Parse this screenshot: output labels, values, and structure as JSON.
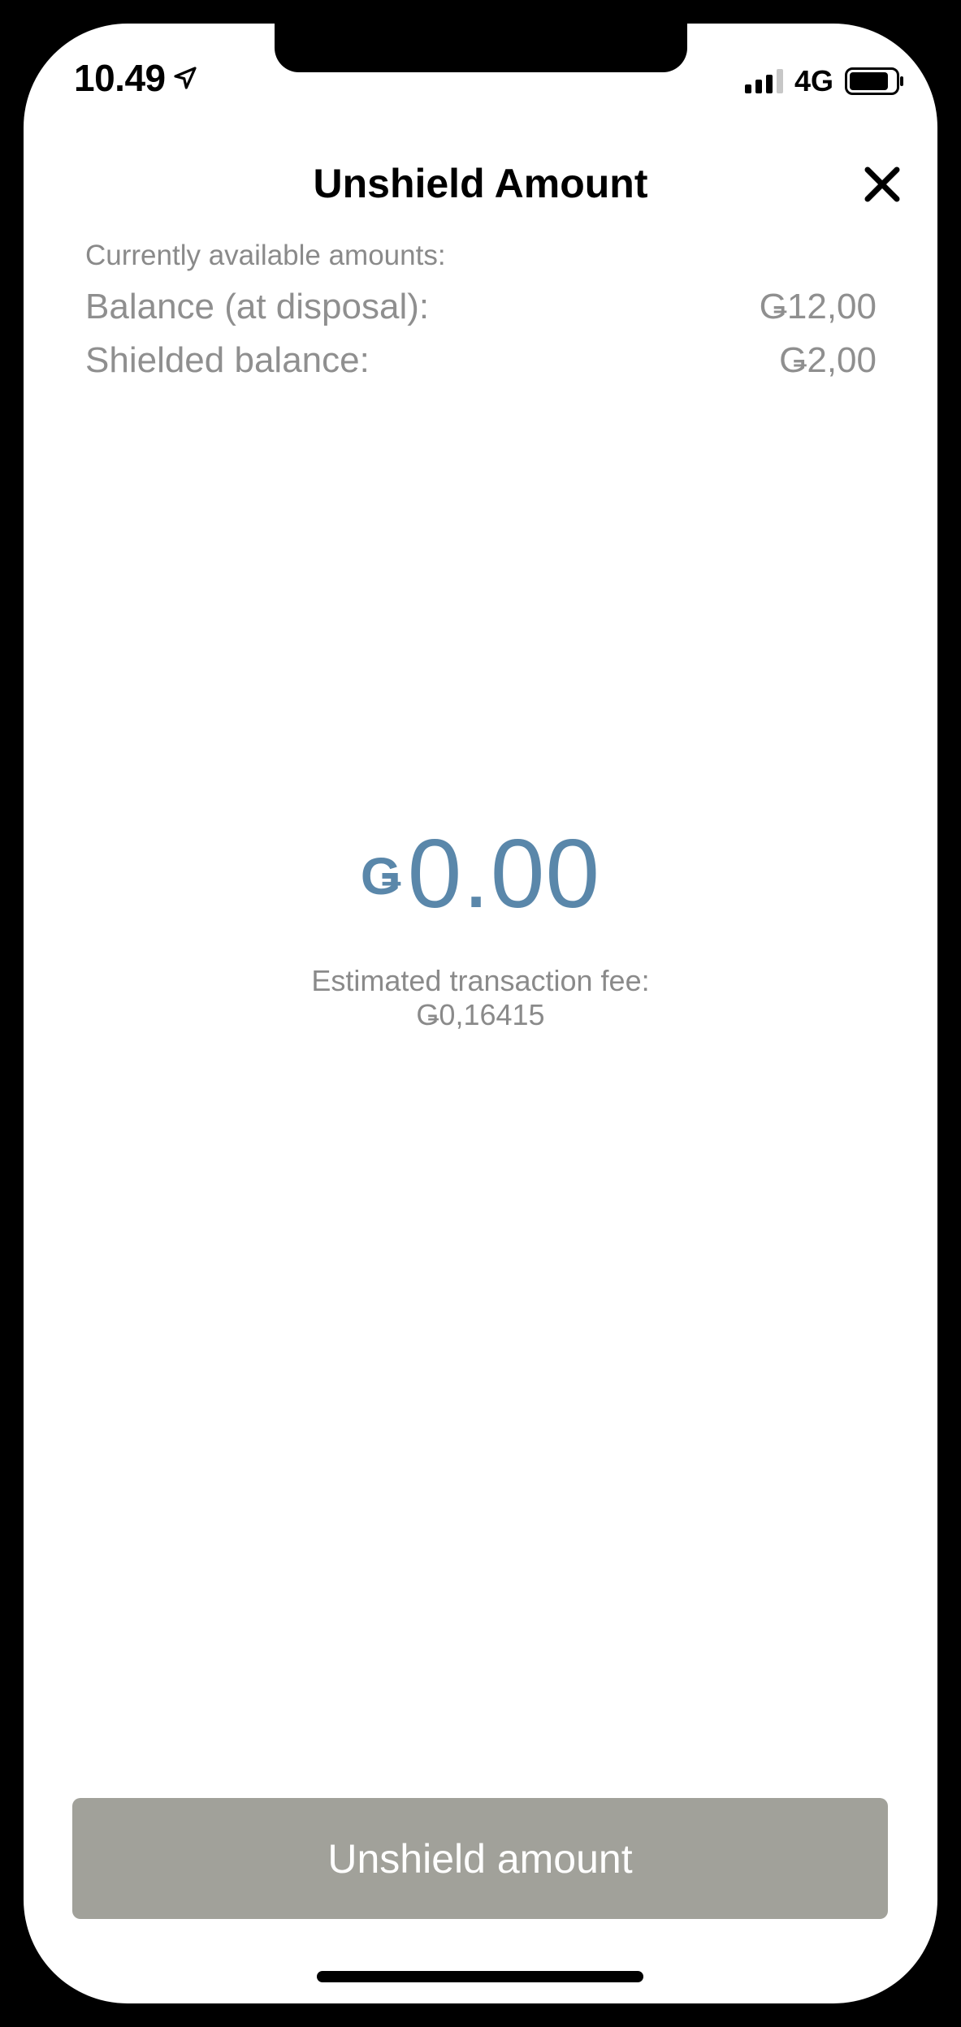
{
  "status_bar": {
    "time": "10.49",
    "network": "4G",
    "icons": [
      "location-arrow-icon",
      "signal-bars-icon",
      "battery-icon"
    ]
  },
  "header": {
    "title": "Unshield Amount",
    "close_icon": "close-icon"
  },
  "balances": {
    "label": "Currently available amounts:",
    "rows": [
      {
        "label": "Balance (at disposal):",
        "value": "Ǥ12,00"
      },
      {
        "label": "Shielded balance:",
        "value": "Ǥ2,00"
      }
    ]
  },
  "amount": {
    "currency": "Ǥ",
    "value": "0.00"
  },
  "fee": {
    "label": "Estimated transaction fee:",
    "value": "Ǥ0,16415"
  },
  "action": {
    "button_label": "Unshield amount"
  },
  "colors": {
    "amount": "#5a87aa",
    "button_disabled": "#a1a19a",
    "muted_text": "#8a8a8a"
  }
}
